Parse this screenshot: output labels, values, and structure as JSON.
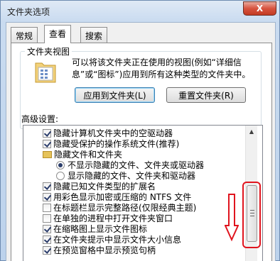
{
  "window": {
    "title": "文件夹选项",
    "close_label": "X"
  },
  "tabs": [
    {
      "label": "常规",
      "active": false
    },
    {
      "label": "查看",
      "active": true
    },
    {
      "label": "搜索",
      "active": false
    }
  ],
  "folder_views": {
    "group_label": "文件夹视图",
    "description": "可以将该文件夹正在使用的视图(例如“详细信息”或“图标”)应用到所有这种类型的文件夹中。",
    "apply_button": "应用到文件夹(L)",
    "reset_button": "重置文件夹(R)"
  },
  "advanced": {
    "label": "高级设置:",
    "items": [
      {
        "type": "checkbox",
        "checked": true,
        "label": "隐藏计算机文件夹中的空驱动器"
      },
      {
        "type": "checkbox",
        "checked": true,
        "label": "隐藏受保护的操作系统文件(推荐)"
      },
      {
        "type": "folder",
        "label": "隐藏文件和文件夹"
      },
      {
        "type": "radio",
        "checked": true,
        "label": "不显示隐藏的文件、文件夹或驱动器"
      },
      {
        "type": "radio",
        "checked": false,
        "label": "显示隐藏的文件、文件夹和驱动器"
      },
      {
        "type": "checkbox",
        "checked": true,
        "label": "隐藏已知文件类型的扩展名"
      },
      {
        "type": "checkbox",
        "checked": true,
        "label": "用彩色显示加密或压缩的 NTFS 文件"
      },
      {
        "type": "checkbox",
        "checked": false,
        "label": "在标题栏显示完整路径(仅限经典主题)"
      },
      {
        "type": "checkbox",
        "checked": false,
        "label": "在单独的进程中打开文件夹窗口"
      },
      {
        "type": "checkbox",
        "checked": true,
        "label": "在缩略图上显示文件图标"
      },
      {
        "type": "checkbox",
        "checked": true,
        "label": "在文件夹提示中显示文件大小信息"
      },
      {
        "type": "checkbox",
        "checked": true,
        "label": "在预览窗格中显示预览句柄"
      }
    ]
  },
  "colors": {
    "annotation": "#e0141e",
    "titlebar": "#c9dbf0"
  }
}
